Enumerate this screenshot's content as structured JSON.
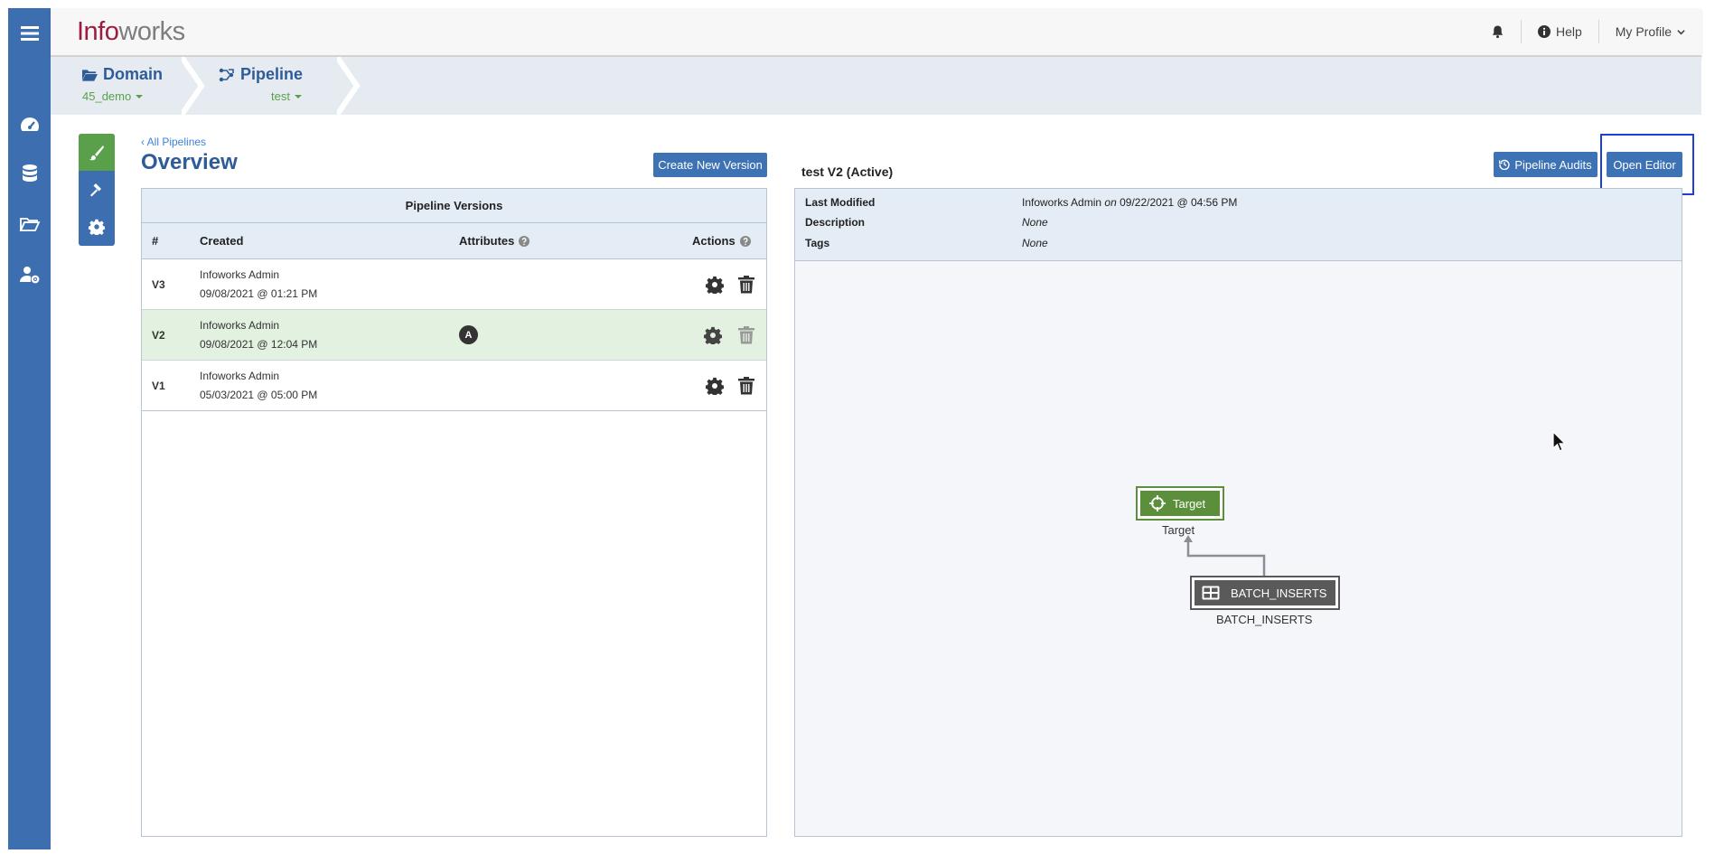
{
  "app": {
    "logo_part1": "Info",
    "logo_part2": "works"
  },
  "topbar": {
    "help_label": "Help",
    "profile_label": "My Profile"
  },
  "breadcrumb": {
    "domain_title": "Domain",
    "domain_value": "45_demo",
    "pipeline_title": "Pipeline",
    "pipeline_value": "test"
  },
  "overview": {
    "back_link": "‹ All Pipelines",
    "title": "Overview",
    "create_button": "Create New Version"
  },
  "versions_table": {
    "heading": "Pipeline Versions",
    "columns": {
      "number": "#",
      "created": "Created",
      "attributes": "Attributes",
      "actions": "Actions"
    },
    "rows": [
      {
        "id": "V3",
        "author": "Infoworks Admin",
        "date": "09/08/2021 @ 01:21 PM",
        "badge": ""
      },
      {
        "id": "V2",
        "author": "Infoworks Admin",
        "date": "09/08/2021 @ 12:04 PM",
        "badge": "A"
      },
      {
        "id": "V1",
        "author": "Infoworks Admin",
        "date": "05/03/2021 @ 05:00 PM",
        "badge": ""
      }
    ]
  },
  "detail": {
    "title": "test V2 (Active)",
    "audits_button": "Pipeline Audits",
    "editor_button": "Open Editor",
    "last_modified_label": "Last Modified",
    "last_modified_user": "Infoworks Admin",
    "last_modified_on": "on",
    "last_modified_date": "09/22/2021 @ 04:56 PM",
    "description_label": "Description",
    "description_value": "None",
    "tags_label": "Tags",
    "tags_value": "None"
  },
  "graph": {
    "target_node_label": "Target",
    "target_caption": "Target",
    "source_node_label": "BATCH_INSERTS",
    "source_caption": "BATCH_INSERTS"
  },
  "colors": {
    "rail": "#3d6fb0",
    "accent_green": "#5aa04a",
    "title_blue": "#2e5c99",
    "logo_red": "#9c1e3f",
    "highlight": "#1f3fd6"
  }
}
